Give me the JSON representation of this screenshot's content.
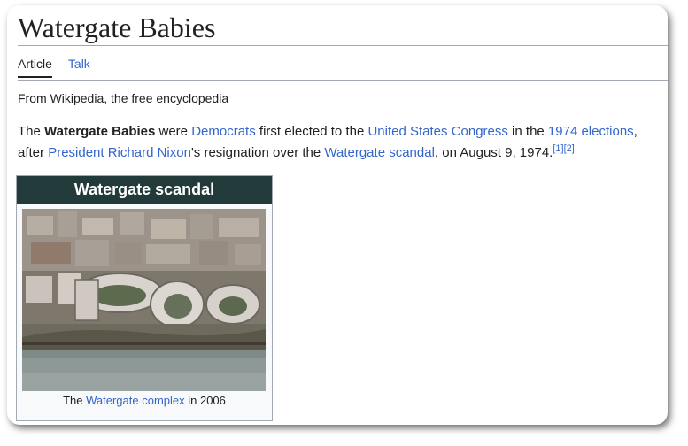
{
  "article": {
    "title": "Watergate Babies",
    "tabs": [
      {
        "label": "Article",
        "active": true
      },
      {
        "label": "Talk",
        "active": false
      }
    ],
    "tagline": "From Wikipedia, the free encyclopedia",
    "intro": {
      "s1_the": "The ",
      "s1_bold": "Watergate Babies",
      "s1_were": " were ",
      "link_democrats": "Democrats",
      "s1_first": " first elected to the ",
      "link_congress": "United States Congress",
      "s1_in": " in the ",
      "link_elections": "1974 elections",
      "s1_after": ", after ",
      "link_nixon": "President Richard Nixon",
      "s1_resign": "'s resignation over the ",
      "link_scandal": "Watergate scandal",
      "s1_date": ", on August 9, 1974.",
      "ref1": "[1]",
      "ref2": "[2]"
    }
  },
  "infobox": {
    "header": "Watergate scandal",
    "caption_pre": "The ",
    "caption_link": "Watergate complex",
    "caption_post": " in 2006",
    "header_color": "#233a3a"
  },
  "colors": {
    "link": "#3366cc",
    "text": "#202122"
  }
}
